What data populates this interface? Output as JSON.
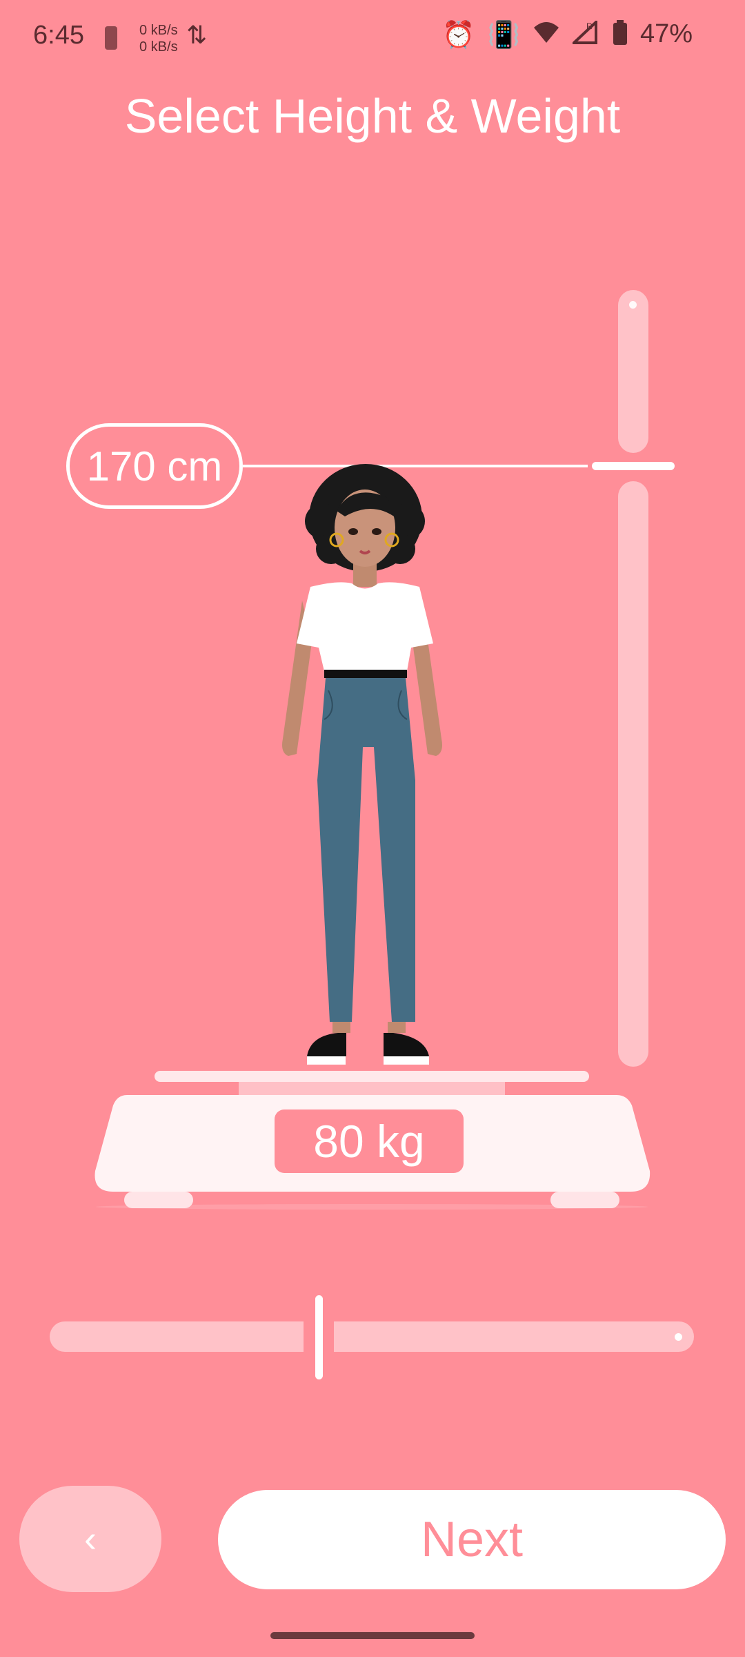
{
  "status_bar": {
    "time": "6:45",
    "net_up": "0 kB/s",
    "net_down": "0 kB/s",
    "battery_percent": "47%",
    "icons": [
      "battery-low-icon",
      "data-arrows-icon",
      "alarm-icon",
      "vibrate-icon",
      "wifi-icon",
      "signal-roaming-icon",
      "battery-icon"
    ]
  },
  "title": "Select Height & Weight",
  "height": {
    "label": "170 cm",
    "value_cm": 170
  },
  "weight": {
    "label": "80 kg",
    "value_kg": 80
  },
  "buttons": {
    "back_label": "‹",
    "next_label": "Next"
  },
  "colors": {
    "background": "#FF8E98",
    "track": "#FFC2C8",
    "white": "#FFFFFF"
  }
}
